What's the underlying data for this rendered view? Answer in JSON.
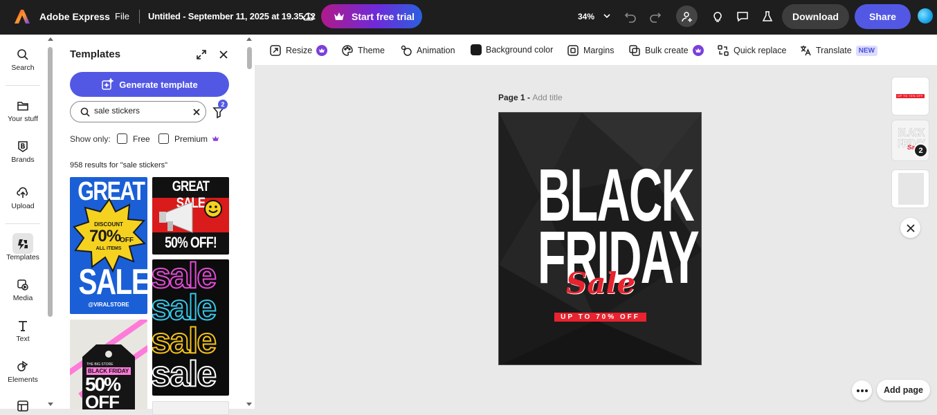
{
  "topbar": {
    "app_title": "Adobe Express",
    "file_menu": "File",
    "doc_title": "Untitled - September 11, 2025 at 19.35.12",
    "trial_button": "Start free trial",
    "zoom": "34%",
    "download": "Download",
    "share": "Share"
  },
  "rail": {
    "items": [
      {
        "label": "Search",
        "icon": "search-icon"
      },
      {
        "label": "Your stuff",
        "icon": "folder-icon"
      },
      {
        "label": "Brands",
        "icon": "brand-icon"
      },
      {
        "label": "Upload",
        "icon": "upload-icon"
      },
      {
        "label": "Templates",
        "icon": "templates-icon"
      },
      {
        "label": "Media",
        "icon": "media-icon"
      },
      {
        "label": "Text",
        "icon": "text-icon"
      },
      {
        "label": "Elements",
        "icon": "elements-icon"
      }
    ],
    "active": "Templates"
  },
  "panel": {
    "title": "Templates",
    "generate_button": "Generate template",
    "search_value": "sale stickers",
    "filter_count": "2",
    "show_only": "Show only:",
    "filter_free": "Free",
    "filter_premium": "Premium",
    "results": "958 results for \"sale stickers\"",
    "thumbs": {
      "t1": {
        "line1": "GREAT",
        "badge1": "DISCOUNT",
        "badge2": "70%",
        "badge3": "OFF",
        "badge4": "ALL ITEMS",
        "line2": "SALE",
        "handle": "@VIRALSTORE"
      },
      "t2": {
        "line1": "GREAT SALE",
        "line2": "50% OFF!"
      },
      "t3": {
        "word": "sale"
      },
      "t4": {
        "store": "THE BIG STORE",
        "line1": "BLACK FRIDAY",
        "line2": "50%",
        "line3": "OFF"
      }
    }
  },
  "toolbar": {
    "resize": "Resize",
    "theme": "Theme",
    "animation": "Animation",
    "background_color": "Background color",
    "margins": "Margins",
    "bulk_create": "Bulk create",
    "quick_replace": "Quick replace",
    "translate": "Translate",
    "new_badge": "NEW"
  },
  "page": {
    "label": "Page 1 - ",
    "add_title": "Add title"
  },
  "design": {
    "line1": "BLACK",
    "line2": "FRIDAY",
    "script": "Sale",
    "banner": "UP TO 70% OFF"
  },
  "pages_rail": {
    "thumb1_text": "UP TO 70% OFF",
    "thumb2_line1": "BLACK",
    "thumb2_line2": "FRIDAY",
    "thumb2_script": "Sale",
    "thumb2_badge": "2"
  },
  "bottom": {
    "add_page": "Add page"
  },
  "colors": {
    "accent": "#5258e4",
    "topbar": "#1e1e1e",
    "sale_red": "#e8232f"
  }
}
